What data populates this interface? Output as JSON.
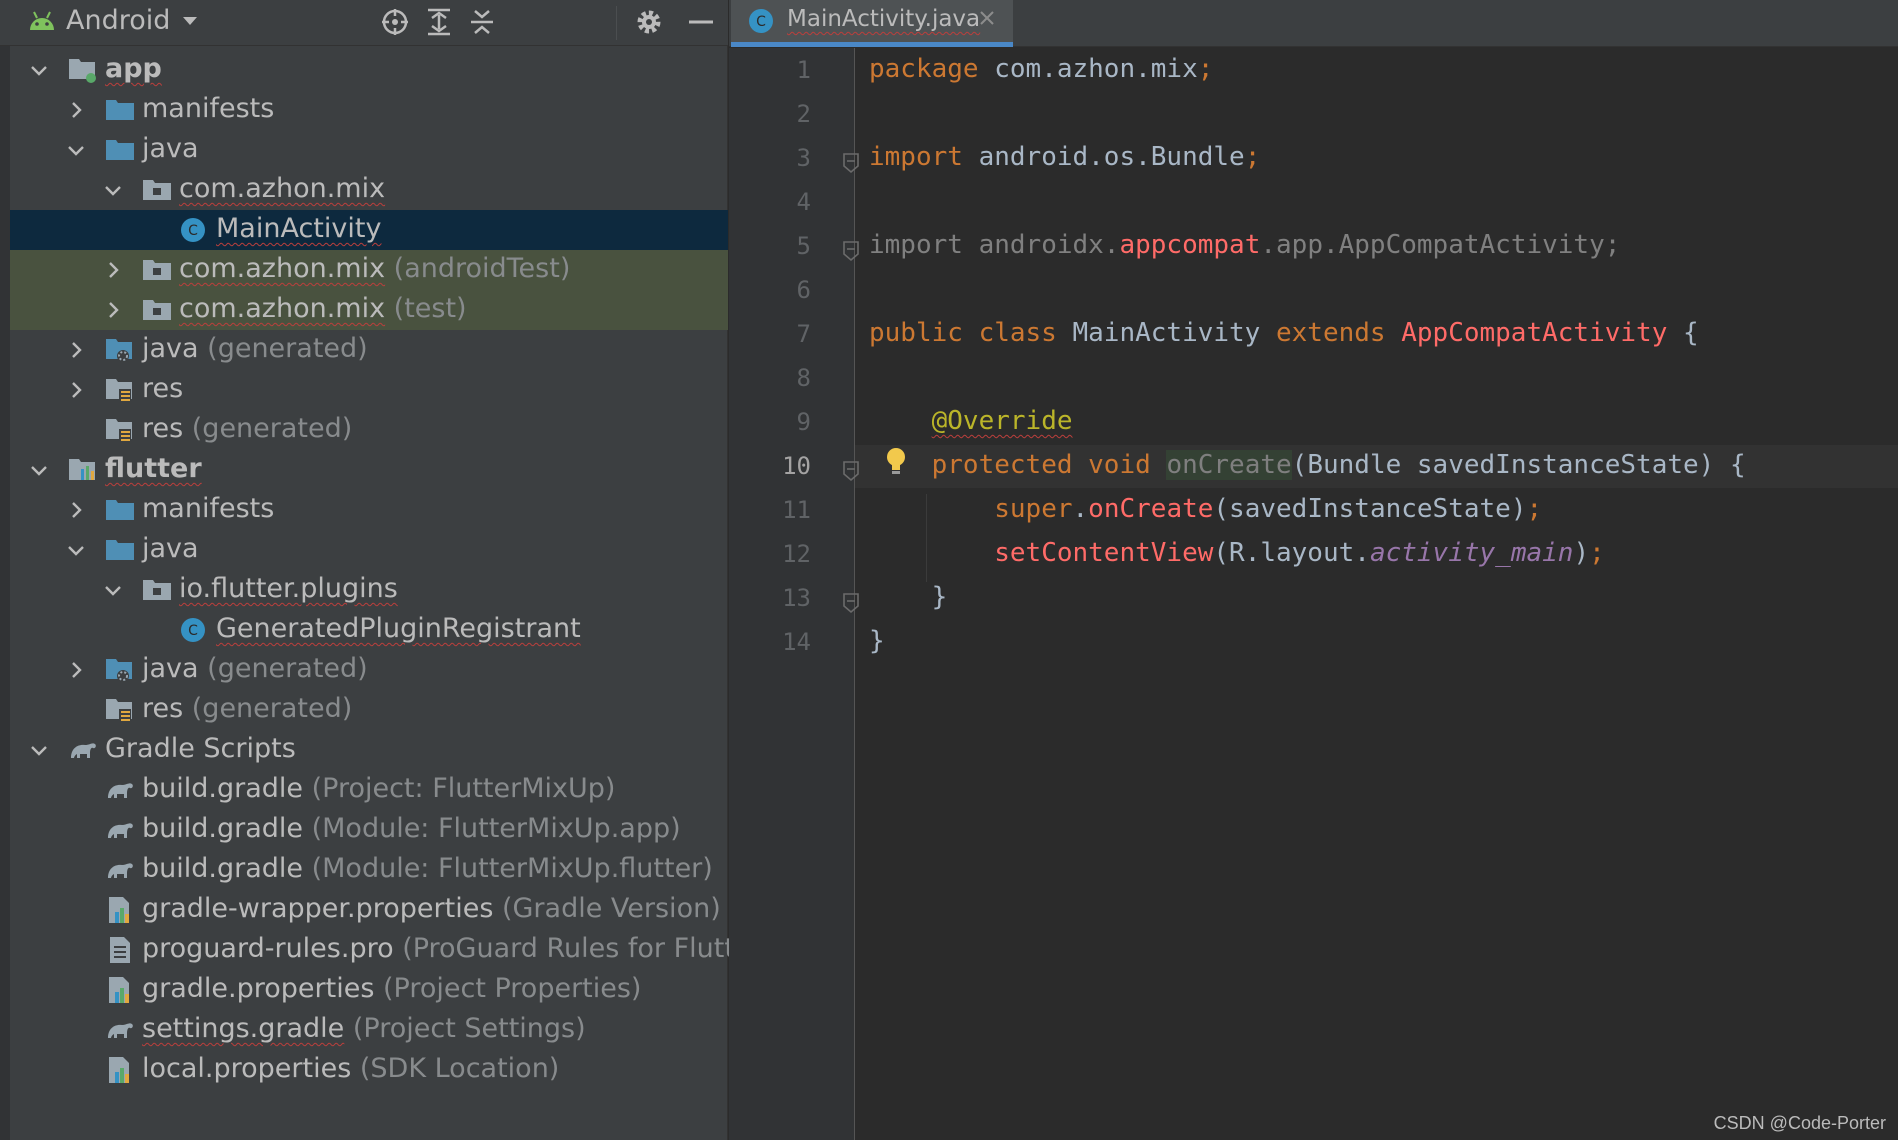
{
  "panel": {
    "view_selector": "Android",
    "tree": [
      {
        "label": "app",
        "sub": "",
        "level": 0,
        "expanded": true,
        "icon": "module-app-icon",
        "bold": true,
        "squiggle": true
      },
      {
        "label": "manifests",
        "sub": "",
        "level": 1,
        "expanded": false,
        "icon": "folder-icon"
      },
      {
        "label": "java",
        "sub": "",
        "level": 1,
        "expanded": true,
        "icon": "folder-icon"
      },
      {
        "label": "com.azhon.mix",
        "sub": "",
        "level": 2,
        "expanded": true,
        "icon": "package-icon",
        "squiggle": true
      },
      {
        "label": "MainActivity",
        "sub": "",
        "level": 3,
        "icon": "java-class-icon",
        "selected": true,
        "squiggle": true
      },
      {
        "label": "com.azhon.mix",
        "sub": " (androidTest)",
        "level": 2,
        "expanded": false,
        "icon": "package-icon",
        "tinted": true,
        "squiggle": true
      },
      {
        "label": "com.azhon.mix",
        "sub": " (test)",
        "level": 2,
        "expanded": false,
        "icon": "package-icon",
        "tinted": true,
        "squiggle": true
      },
      {
        "label": "java",
        "sub": " (generated)",
        "level": 1,
        "expanded": false,
        "icon": "generated-folder-icon"
      },
      {
        "label": "res",
        "sub": "",
        "level": 1,
        "expanded": false,
        "icon": "res-folder-icon"
      },
      {
        "label": "res",
        "sub": " (generated)",
        "level": 1,
        "icon": "res-folder-icon"
      },
      {
        "label": "flutter",
        "sub": "",
        "level": 0,
        "expanded": true,
        "icon": "module-library-icon",
        "bold": true,
        "squiggle": true
      },
      {
        "label": "manifests",
        "sub": "",
        "level": 1,
        "expanded": false,
        "icon": "folder-icon"
      },
      {
        "label": "java",
        "sub": "",
        "level": 1,
        "expanded": true,
        "icon": "folder-icon"
      },
      {
        "label": "io.flutter.plugins",
        "sub": "",
        "level": 2,
        "expanded": true,
        "icon": "package-icon",
        "squiggle": true
      },
      {
        "label": "GeneratedPluginRegistrant",
        "sub": "",
        "level": 3,
        "icon": "java-class-icon",
        "squiggle": true
      },
      {
        "label": "java",
        "sub": " (generated)",
        "level": 1,
        "expanded": false,
        "icon": "generated-folder-icon"
      },
      {
        "label": "res",
        "sub": " (generated)",
        "level": 1,
        "icon": "res-folder-icon"
      },
      {
        "label": "Gradle Scripts",
        "sub": "",
        "level": 0,
        "expanded": true,
        "icon": "gradle-icon"
      },
      {
        "label": "build.gradle",
        "sub": " (Project: FlutterMixUp)",
        "level": 1,
        "icon": "gradle-icon"
      },
      {
        "label": "build.gradle",
        "sub": " (Module: FlutterMixUp.app)",
        "level": 1,
        "icon": "gradle-icon"
      },
      {
        "label": "build.gradle",
        "sub": " (Module: FlutterMixUp.flutter)",
        "level": 1,
        "icon": "gradle-icon"
      },
      {
        "label": "gradle-wrapper.properties",
        "sub": " (Gradle Version)",
        "level": 1,
        "icon": "properties-icon"
      },
      {
        "label": "proguard-rules.pro",
        "sub": " (ProGuard Rules for Flutter",
        "level": 1,
        "icon": "text-file-icon"
      },
      {
        "label": "gradle.properties",
        "sub": " (Project Properties)",
        "level": 1,
        "icon": "properties-icon"
      },
      {
        "label": "settings.gradle",
        "sub": " (Project Settings)",
        "level": 1,
        "icon": "gradle-icon",
        "squiggle": true
      },
      {
        "label": "local.properties",
        "sub": " (SDK Location)",
        "level": 1,
        "icon": "properties-icon"
      }
    ]
  },
  "editor": {
    "tab_label": "MainActivity.java",
    "current_line": 10,
    "lines": [
      {
        "n": "1",
        "tokens": [
          {
            "t": "package ",
            "c": "kw"
          },
          {
            "t": "com.azhon.mix",
            "c": ""
          },
          {
            "t": ";",
            "c": "kw"
          }
        ]
      },
      {
        "n": "2",
        "tokens": []
      },
      {
        "n": "3",
        "tokens": [
          {
            "t": "import ",
            "c": "kw"
          },
          {
            "t": "android.os.Bundle",
            "c": ""
          },
          {
            "t": ";",
            "c": "kw"
          }
        ]
      },
      {
        "n": "4",
        "tokens": []
      },
      {
        "n": "5",
        "tokens": [
          {
            "t": "import ",
            "c": "dim"
          },
          {
            "t": "androidx.",
            "c": "dim"
          },
          {
            "t": "appcompat",
            "c": "err"
          },
          {
            "t": ".app.AppCompatActivity;",
            "c": "dim"
          }
        ]
      },
      {
        "n": "6",
        "tokens": []
      },
      {
        "n": "7",
        "tokens": [
          {
            "t": "public class ",
            "c": "kw"
          },
          {
            "t": "MainActivity ",
            "c": ""
          },
          {
            "t": "extends ",
            "c": "kw"
          },
          {
            "t": "AppCompatActivity",
            "c": "err"
          },
          {
            "t": " {",
            "c": ""
          }
        ]
      },
      {
        "n": "8",
        "tokens": []
      },
      {
        "n": "9",
        "tokens": [
          {
            "t": "    ",
            "c": ""
          },
          {
            "t": "@Override",
            "c": "ann"
          }
        ]
      },
      {
        "n": "10",
        "tokens": [
          {
            "t": "    ",
            "c": ""
          },
          {
            "t": "protected void ",
            "c": "kw"
          },
          {
            "t": "onCreate",
            "c": "hl-unused"
          },
          {
            "t": "(Bundle savedInstanceState) {",
            "c": ""
          }
        ]
      },
      {
        "n": "11",
        "tokens": [
          {
            "t": "        ",
            "c": ""
          },
          {
            "t": "super",
            "c": "kw"
          },
          {
            "t": ".",
            "c": ""
          },
          {
            "t": "onCreate",
            "c": "err"
          },
          {
            "t": "(savedInstanceState)",
            "c": ""
          },
          {
            "t": ";",
            "c": "kw"
          }
        ]
      },
      {
        "n": "12",
        "tokens": [
          {
            "t": "        ",
            "c": ""
          },
          {
            "t": "setContentView",
            "c": "err"
          },
          {
            "t": "(R.layout.",
            "c": ""
          },
          {
            "t": "activity_main",
            "c": "fld"
          },
          {
            "t": ")",
            "c": ""
          },
          {
            "t": ";",
            "c": "kw"
          }
        ]
      },
      {
        "n": "13",
        "tokens": [
          {
            "t": "    }",
            "c": ""
          }
        ]
      },
      {
        "n": "14",
        "tokens": [
          {
            "t": "}",
            "c": ""
          }
        ]
      }
    ]
  },
  "watermark": "CSDN @Code-Porter",
  "colors": {
    "selection": "#0d293e",
    "tab_underline": "#4a88c7",
    "keyword": "#cc7832",
    "annotation": "#bbb529",
    "error": "#ff6b68"
  }
}
